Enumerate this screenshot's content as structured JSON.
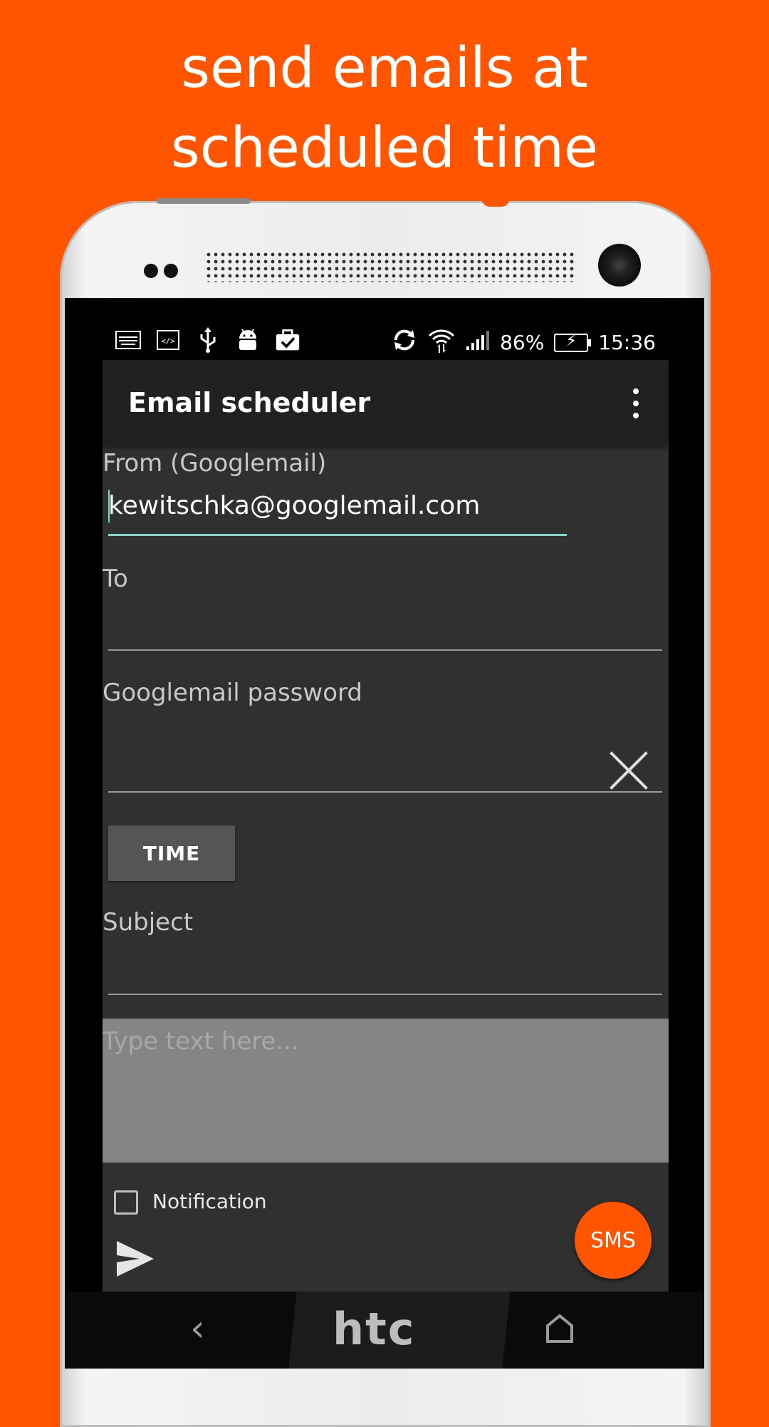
{
  "headline": {
    "line1": "send emails at",
    "line2": "scheduled time"
  },
  "device": {
    "brand": "htc"
  },
  "status_bar": {
    "battery": "86%",
    "time": "15:36",
    "left_icons": [
      "keyboard-icon",
      "code-icon",
      "usb-icon",
      "android-icon",
      "briefcase-check-icon"
    ],
    "right_icons": [
      "sync-icon",
      "wifi-icon",
      "signal-icon",
      "battery-charging-icon"
    ]
  },
  "app_bar": {
    "title": "Email scheduler",
    "menu_icon": "overflow-menu-icon"
  },
  "form": {
    "from_label": "From (Googlemail)",
    "from_value": "kewitschka@googlemail.com",
    "to_label": "To",
    "to_value": "",
    "password_label": "Googlemail password",
    "password_value": "",
    "time_button": "TIME",
    "subject_label": "Subject",
    "subject_value": "",
    "body_placeholder": "Type text here...",
    "notification_label": "Notification",
    "notification_checked": false,
    "sms_button": "SMS"
  },
  "colors": {
    "accent": "#ff5500",
    "screen_bg": "#303030",
    "app_bar_bg": "#212121",
    "body_area_bg": "#858585",
    "focus_line": "#7fd8d0"
  }
}
